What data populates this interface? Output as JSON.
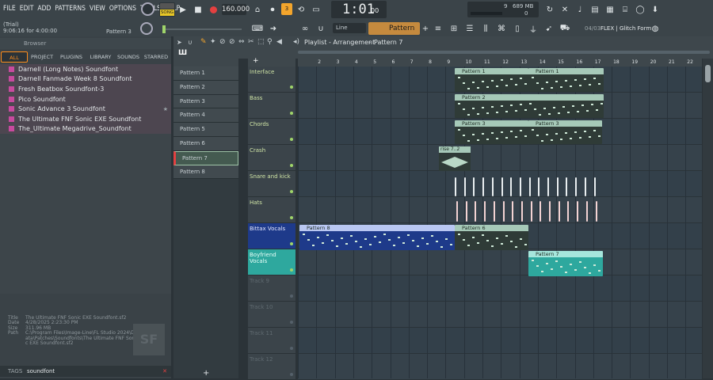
{
  "menu": [
    "FILE",
    "EDIT",
    "ADD",
    "PATTERNS",
    "VIEW",
    "OPTIONS",
    "TOOLS",
    "HELP"
  ],
  "transport": {
    "mode": "SONG",
    "tempo": "160.000",
    "time": "1:01",
    "time_sub": "00",
    "bst": "B:S:T"
  },
  "status": {
    "trial": "(Trial)",
    "position": "9:06:16 for 4:00:00",
    "pattern": "Pattern 3"
  },
  "cpu": {
    "value": "9",
    "mem": "689 MB",
    "pct": "0"
  },
  "snap": "Line",
  "current_pattern": "Pattern 7",
  "news": {
    "date": "04/03",
    "text": "FLEX | Glitch Form"
  },
  "browser": {
    "title": "Browser",
    "tabs": [
      "ALL",
      "PROJECT",
      "PLUGINS",
      "LIBRARY",
      "SOUNDS",
      "STARRED"
    ],
    "items": [
      "Darnell (Long Notes) Soundfont",
      "Darnell Fanmade Week 8 Soundfont",
      "Fresh Beatbox Soundfont-3",
      "Pico Soundfont",
      "Sonic Advance 3 Soundfont",
      "The Ultimate FNF Sonic EXE Soundfont",
      "The_Ultimate Megadrive_Soundfont"
    ],
    "info": {
      "title_label": "Title",
      "title": "The Ultimate FNF Sonic EXE Soundfont.sf2",
      "date_label": "Date",
      "date": "4/28/2025 2:23:30 PM",
      "size_label": "Size",
      "size": "311.96 MB",
      "path_label": "Path",
      "path": "C:\\Program Files\\Image-Line\\FL Studio 2024\\Data\\Patches\\Soundfonts\\The Ultimate FNF Sonic EXE Soundfont.sf2",
      "badge": "SF"
    },
    "tags_label": "TAGS",
    "tags_value": "soundfont"
  },
  "patterns": [
    "Pattern 1",
    "Pattern 2",
    "Pattern 3",
    "Pattern 4",
    "Pattern 5",
    "Pattern 6",
    "Pattern 7",
    "Pattern 8"
  ],
  "playlist": {
    "title": "Playlist - Arrangement",
    "sep": "›",
    "pattern": "Pattern 7",
    "ruler": [
      "2",
      "3",
      "4",
      "5",
      "6",
      "7",
      "8",
      "9",
      "10",
      "11",
      "12",
      "13",
      "14",
      "15",
      "16",
      "17",
      "18",
      "19",
      "20",
      "21",
      "22"
    ],
    "tracks": [
      "Interface",
      "Bass",
      "Chords",
      "Crash",
      "Snare and kick",
      "Hats",
      "Bittax Vocals",
      "Boyfriend Vocals",
      "Track 9",
      "Track 10",
      "Track 11",
      "Track 12"
    ],
    "clips": {
      "p1": "Pattern 1",
      "p2": "Pattern 2",
      "p3": "Pattern 3",
      "rise": "rise",
      "rise2": "7..2",
      "p8": "Pattern 8",
      "p6": "Pattern 6",
      "p7": "Pattern 7"
    }
  },
  "colors": {
    "accent": "#ff8c1a",
    "clip": "#5d7a6e",
    "clip_head": "#a6c9b8",
    "vocal": "#1e3a8a",
    "vocal2": "#2ea89e"
  }
}
